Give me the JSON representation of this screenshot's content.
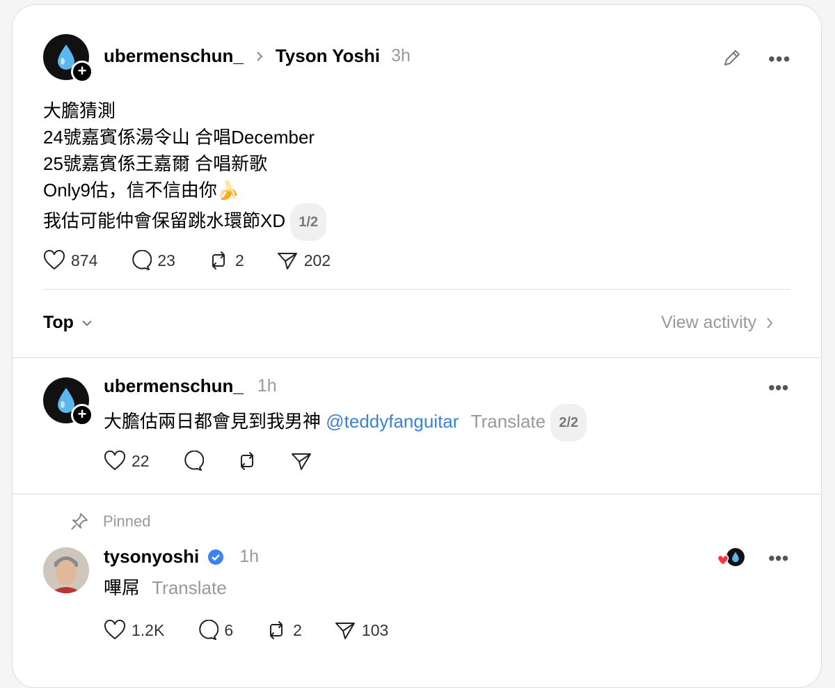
{
  "post": {
    "author": "ubermenschun_",
    "reply_to": "Tyson Yoshi",
    "time": "3h",
    "lines": [
      "大膽猜測",
      "24號嘉賓係湯令山 合唱December",
      "25號嘉賓係王嘉爾 合唱新歌",
      "Only9估，信不信由你🍌",
      "我估可能仲會保留跳水環節XD"
    ],
    "thread_counter": "1/2",
    "likes": "874",
    "comments": "23",
    "reposts": "2",
    "shares": "202"
  },
  "sort": {
    "label": "Top",
    "view_activity": "View activity"
  },
  "reply": {
    "author": "ubermenschun_",
    "time": "1h",
    "text": "大膽估兩日都會見到我男神",
    "mention": "@teddyfanguitar",
    "translate": "Translate",
    "thread_counter": "2/2",
    "likes": "22"
  },
  "pinned": {
    "label": "Pinned",
    "author": "tysonyoshi",
    "time": "1h",
    "text": "嗶屌",
    "translate": "Translate",
    "likes": "1.2K",
    "comments": "6",
    "reposts": "2",
    "shares": "103"
  },
  "colors": {
    "verified": "#3b82f6",
    "mention": "#3b82d6",
    "heart": "#ff3040"
  }
}
